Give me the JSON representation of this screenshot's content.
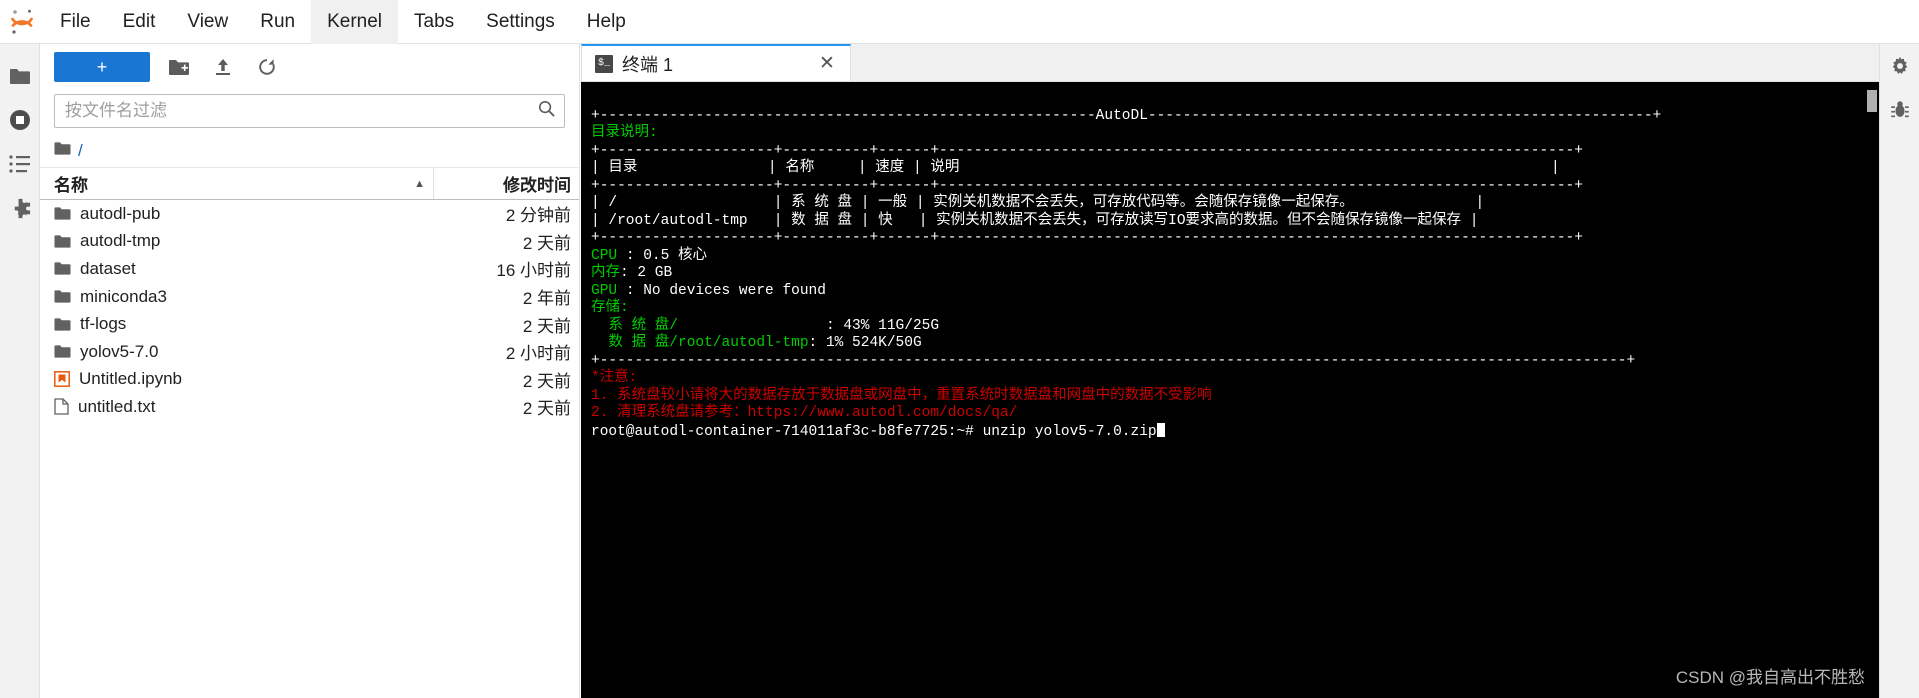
{
  "app": {
    "logo_icon": "jupyter-logo-icon"
  },
  "menubar": {
    "items": [
      {
        "label": "File",
        "active": false
      },
      {
        "label": "Edit",
        "active": false
      },
      {
        "label": "View",
        "active": false
      },
      {
        "label": "Run",
        "active": false
      },
      {
        "label": "Kernel",
        "active": true
      },
      {
        "label": "Tabs",
        "active": false
      },
      {
        "label": "Settings",
        "active": false
      },
      {
        "label": "Help",
        "active": false
      }
    ]
  },
  "activitybar": {
    "items": [
      {
        "icon": "folder-icon",
        "name": "file-browser"
      },
      {
        "icon": "stop-circle-icon",
        "name": "running-sessions"
      },
      {
        "icon": "list-icon",
        "name": "table-of-contents"
      },
      {
        "icon": "puzzle-icon",
        "name": "extension-manager"
      }
    ]
  },
  "activitybar_right": {
    "items": [
      {
        "icon": "gear-icon",
        "name": "property-inspector"
      },
      {
        "icon": "debug-icon",
        "name": "debugger"
      }
    ]
  },
  "filebrowser": {
    "toolbar": {
      "new_launcher_label": "+",
      "new_folder_icon": "new-folder-icon",
      "upload_icon": "upload-icon",
      "refresh_icon": "refresh-icon"
    },
    "filter": {
      "placeholder": "按文件名过滤",
      "value": "",
      "search_icon": "search-icon"
    },
    "breadcrumb": {
      "root_icon": "folder-icon",
      "path": "/"
    },
    "columns": {
      "name": "名称",
      "last_modified": "修改时间",
      "sort_caret": "▲"
    },
    "rows": [
      {
        "icon": "folder-icon",
        "name": "autodl-pub",
        "modified": "2 分钟前"
      },
      {
        "icon": "folder-icon",
        "name": "autodl-tmp",
        "modified": "2 天前"
      },
      {
        "icon": "folder-icon",
        "name": "dataset",
        "modified": "16 小时前"
      },
      {
        "icon": "folder-icon",
        "name": "miniconda3",
        "modified": "2 年前"
      },
      {
        "icon": "folder-icon",
        "name": "tf-logs",
        "modified": "2 天前"
      },
      {
        "icon": "folder-icon",
        "name": "yolov5-7.0",
        "modified": "2 小时前"
      },
      {
        "icon": "notebook-icon",
        "name": "Untitled.ipynb",
        "modified": "2 天前"
      },
      {
        "icon": "file-icon",
        "name": "untitled.txt",
        "modified": "2 天前"
      }
    ]
  },
  "dock": {
    "tabs": [
      {
        "icon": "terminal-icon",
        "title": "终端 1",
        "close": "✕",
        "active": true
      }
    ]
  },
  "terminal": {
    "banner_rule_top": "+---------------------------------------------------------AutoDL----------------------------------------------------------+",
    "dir_section_title": "目录说明:",
    "table": {
      "top_border": "+--------------------+----------+------+-------------------------------------------------------------------------+",
      "header_cells": "| 目录               | 名称     | 速度 | 说明                                                                    |",
      "mid_border": "+--------------------+----------+------+-------------------------------------------------------------------------+",
      "row1": "| /                  | 系 统 盘 | 一般 | 实例关机数据不会丢失，可存放代码等。会随保存镜像一起保存。              |",
      "row2": "| /root/autodl-tmp   | 数 据 盘 | 快   | 实例关机数据不会丢失，可存放读写IO要求高的数据。但不会随保存镜像一起保存 |",
      "bottom_border": "+--------------------+----------+------+-------------------------------------------------------------------------+"
    },
    "specs": [
      {
        "label": "CPU ",
        "sep": ": ",
        "value": "0.5 核心"
      },
      {
        "label": "内存",
        "sep": ": ",
        "value": "2 GB"
      },
      {
        "label": "GPU ",
        "sep": ": ",
        "value": "No devices were found"
      }
    ],
    "storage_label": "存储:",
    "storage_rows": [
      {
        "label": "  系 统 盘/                 ",
        "sep": ": ",
        "value": "43% 11G/25G"
      },
      {
        "label": "  数 据 盘/root/autodl-tmp",
        "sep": ": ",
        "value": "1% 524K/50G"
      }
    ],
    "banner_rule_bottom": "+----------------------------------------------------------------------------------------------------------------------+",
    "notices": [
      "*注意:",
      "1. 系统盘较小请将大的数据存放于数据盘或网盘中，重置系统时数据盘和网盘中的数据不受影响",
      "2. 清理系统盘请参考："
    ],
    "notice_url": "https://www.autodl.com/docs/qa/",
    "prompt": "root@autodl-container-714011af3c-b8fe7725:~# ",
    "command": "unzip yolov5-7.0.zip"
  },
  "watermark": {
    "text": "CSDN @我自高出不胜愁"
  },
  "colors": {
    "accent_blue": "#1976d2",
    "tab_active_top": "#2196f3",
    "terminal_bg": "#000000",
    "terminal_green": "#00cd00",
    "terminal_red": "#cd0000",
    "notebook_orange": "#e8590c"
  }
}
